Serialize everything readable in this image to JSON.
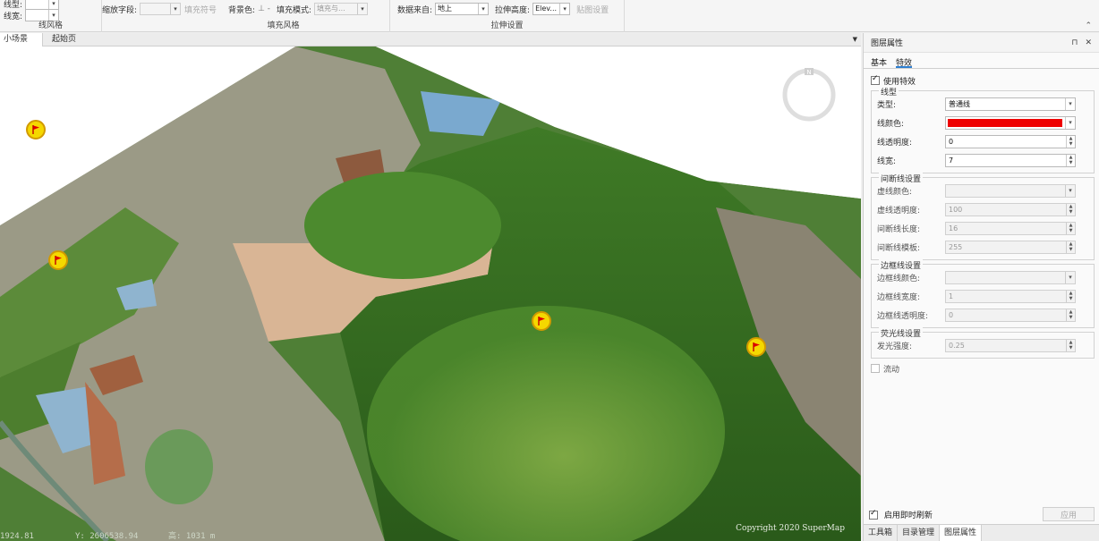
{
  "ribbon": {
    "line_style": {
      "title": "线风格",
      "line_type_label": "线型:",
      "line_width_label": "线宽:",
      "line_type_value": "",
      "line_width_value": ""
    },
    "scale_field_label": "缩放字段:",
    "scale_field_value": "",
    "fill_style": {
      "title": "填充风格",
      "fill_symbol_label": "填充符号",
      "bg_color_label": "背景色:",
      "fill_mode_label": "填充模式:",
      "fill_mode_value": "填充与..."
    },
    "extrude": {
      "title": "拉伸设置",
      "data_source_label": "数据来自:",
      "data_source_value": "地上",
      "extrude_height_label": "拉伸高度:",
      "extrude_height_value": "Elev...",
      "texture_label": "贴图设置"
    }
  },
  "tabs": [
    {
      "label": "小场景",
      "close": "✕"
    },
    {
      "label": "起始页"
    }
  ],
  "viewport": {
    "status_x": "1924.81",
    "status_y": "Y: 2606538.94",
    "status_h": "高: 1031 m",
    "copyright": "Copyright 2020 SuperMap"
  },
  "panel": {
    "title": "图层属性",
    "pin": "⊓",
    "close": "✕",
    "subtabs": [
      "基本",
      "特效"
    ],
    "use_effect_label": "使用特效",
    "line_group": {
      "title": "线型",
      "type_label": "类型:",
      "type_value": "普通线",
      "color_label": "线颜色:",
      "color_value": "#ee0000",
      "opacity_label": "线透明度:",
      "opacity_value": "0",
      "width_label": "线宽:",
      "width_value": "7"
    },
    "dash_group": {
      "title": "间断线设置",
      "color_label": "虚线颜色:",
      "opacity_label": "虚线透明度:",
      "opacity_value": "100",
      "length_label": "间断线长度:",
      "length_value": "16",
      "pattern_label": "间断线模板:",
      "pattern_value": "255"
    },
    "border_group": {
      "title": "边框线设置",
      "color_label": "边框线颜色:",
      "width_label": "边框线宽度:",
      "width_value": "1",
      "opacity_label": "边框线透明度:",
      "opacity_value": "0"
    },
    "glow_group": {
      "title": "荧光线设置",
      "strength_label": "发光强度:",
      "strength_value": "0.25"
    },
    "flow_label": "流动",
    "realtime_label": "启用即时刷新",
    "apply_label": "应用",
    "bottom_tabs": [
      "工具箱",
      "目录管理",
      "图层属性"
    ]
  }
}
